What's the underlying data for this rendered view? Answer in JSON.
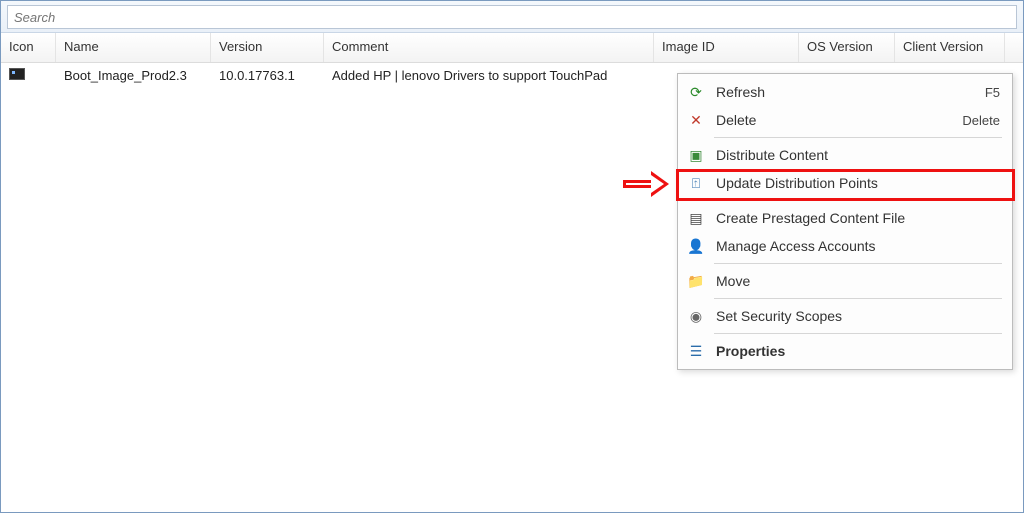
{
  "search": {
    "placeholder": "Search"
  },
  "columns": {
    "icon": "Icon",
    "name": "Name",
    "version": "Version",
    "comment": "Comment",
    "image_id": "Image ID",
    "os_version": "OS Version",
    "client_version": "Client Version"
  },
  "rows": [
    {
      "name": "Boot_Image_Prod2.3",
      "version": "10.0.17763.1",
      "comment": "Added HP | lenovo Drivers to support TouchPad",
      "image_id": "",
      "os_version": "",
      "client_version": ""
    }
  ],
  "context_menu": {
    "refresh": {
      "label": "Refresh",
      "accel": "F5"
    },
    "delete": {
      "label": "Delete",
      "accel": "Delete"
    },
    "distribute": {
      "label": "Distribute Content"
    },
    "update": {
      "label": "Update Distribution Points"
    },
    "prestage": {
      "label": "Create Prestaged Content File"
    },
    "accounts": {
      "label": "Manage Access Accounts"
    },
    "move": {
      "label": "Move"
    },
    "scopes": {
      "label": "Set Security Scopes"
    },
    "properties": {
      "label": "Properties"
    }
  },
  "annotation": {
    "highlighted_item": "update"
  }
}
